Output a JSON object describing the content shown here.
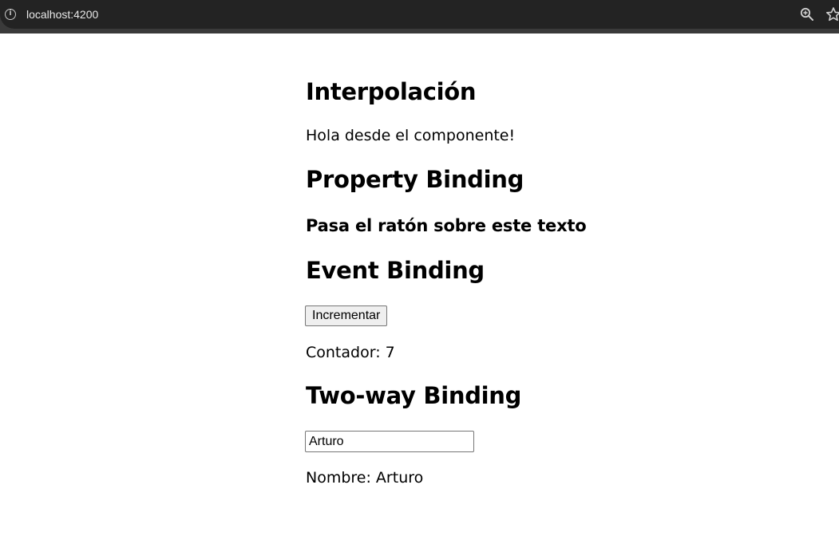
{
  "browser": {
    "url": "localhost:4200",
    "info_icon": "info-icon",
    "zoom_icon": "zoom-in-icon",
    "bookmark_icon": "star-icon"
  },
  "sections": {
    "interpolation": {
      "title": "Interpolación",
      "message": "Hola desde el componente!"
    },
    "property_binding": {
      "title": "Property Binding",
      "hover_text": "Pasa el ratón sobre este texto"
    },
    "event_binding": {
      "title": "Event Binding",
      "button_label": "Incrementar",
      "counter_text": "Contador: 7"
    },
    "two_way_binding": {
      "title": "Two-way Binding",
      "input_value": "Arturo",
      "name_text": "Nombre: Arturo"
    }
  }
}
